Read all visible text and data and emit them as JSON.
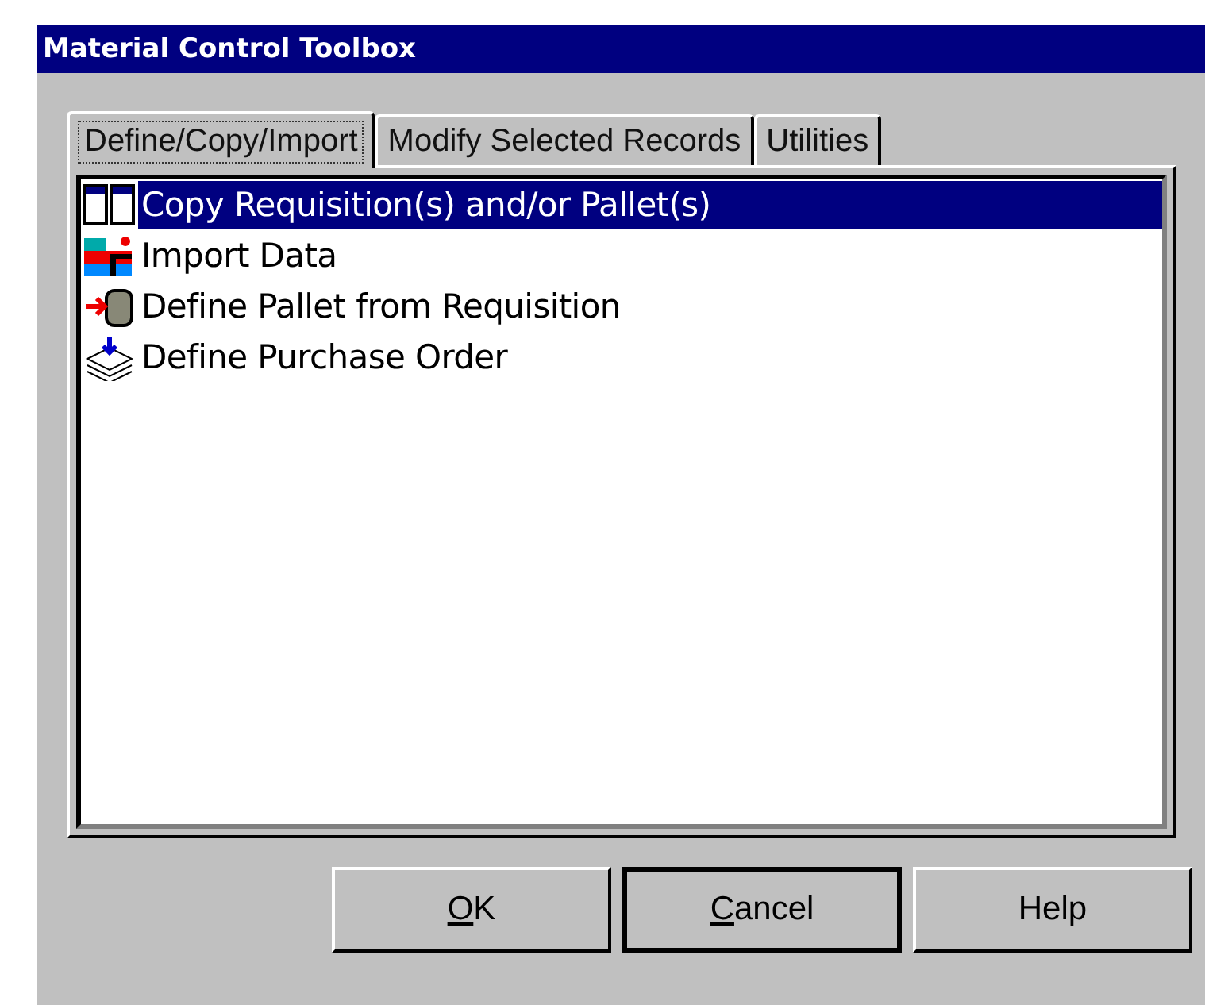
{
  "window": {
    "title": "Material Control Toolbox"
  },
  "tabs": [
    {
      "label": "Define/Copy/Import",
      "selected": true
    },
    {
      "label": "Modify Selected Records",
      "selected": false
    },
    {
      "label": "Utilities",
      "selected": false
    }
  ],
  "list": [
    {
      "kind": "copy",
      "label": "Copy Requisition(s) and/or Pallet(s)",
      "selected": true
    },
    {
      "kind": "import",
      "label": "Import Data",
      "selected": false
    },
    {
      "kind": "pallet",
      "label": "Define Pallet from Requisition",
      "selected": false
    },
    {
      "kind": "order",
      "label": "Define Purchase Order",
      "selected": false
    }
  ],
  "buttons": [
    {
      "label": "OK",
      "mnemonic": true,
      "default": false
    },
    {
      "label": "Cancel",
      "mnemonic": true,
      "default": true
    },
    {
      "label": "Help",
      "mnemonic": false,
      "default": false
    }
  ]
}
